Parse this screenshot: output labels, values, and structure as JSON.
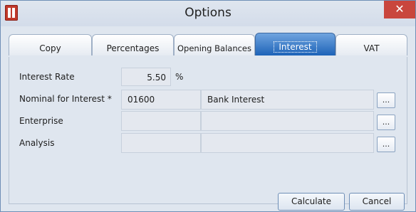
{
  "window": {
    "title": "Options",
    "close_glyph": "✕",
    "app_icon": "sage-app-icon"
  },
  "tabs": [
    {
      "label": "Copy",
      "active": false
    },
    {
      "label": "Percentages",
      "active": false
    },
    {
      "label": "Opening Balances",
      "active": false
    },
    {
      "label": "Interest",
      "active": true
    },
    {
      "label": "VAT",
      "active": false
    }
  ],
  "form": {
    "interest_rate": {
      "label": "Interest Rate",
      "value": "5.50",
      "unit": "%"
    },
    "nominal": {
      "label": "Nominal for Interest *",
      "code": "01600",
      "name": "Bank Interest",
      "button": "..."
    },
    "enterprise": {
      "label": "Enterprise",
      "code": "",
      "name": "",
      "button": "..."
    },
    "analysis": {
      "label": "Analysis",
      "code": "",
      "name": "",
      "button": "..."
    }
  },
  "buttons": {
    "calculate": "Calculate",
    "cancel": "Cancel"
  },
  "colors": {
    "active_tab": "#1d63b8",
    "close_button": "#c9463d"
  }
}
